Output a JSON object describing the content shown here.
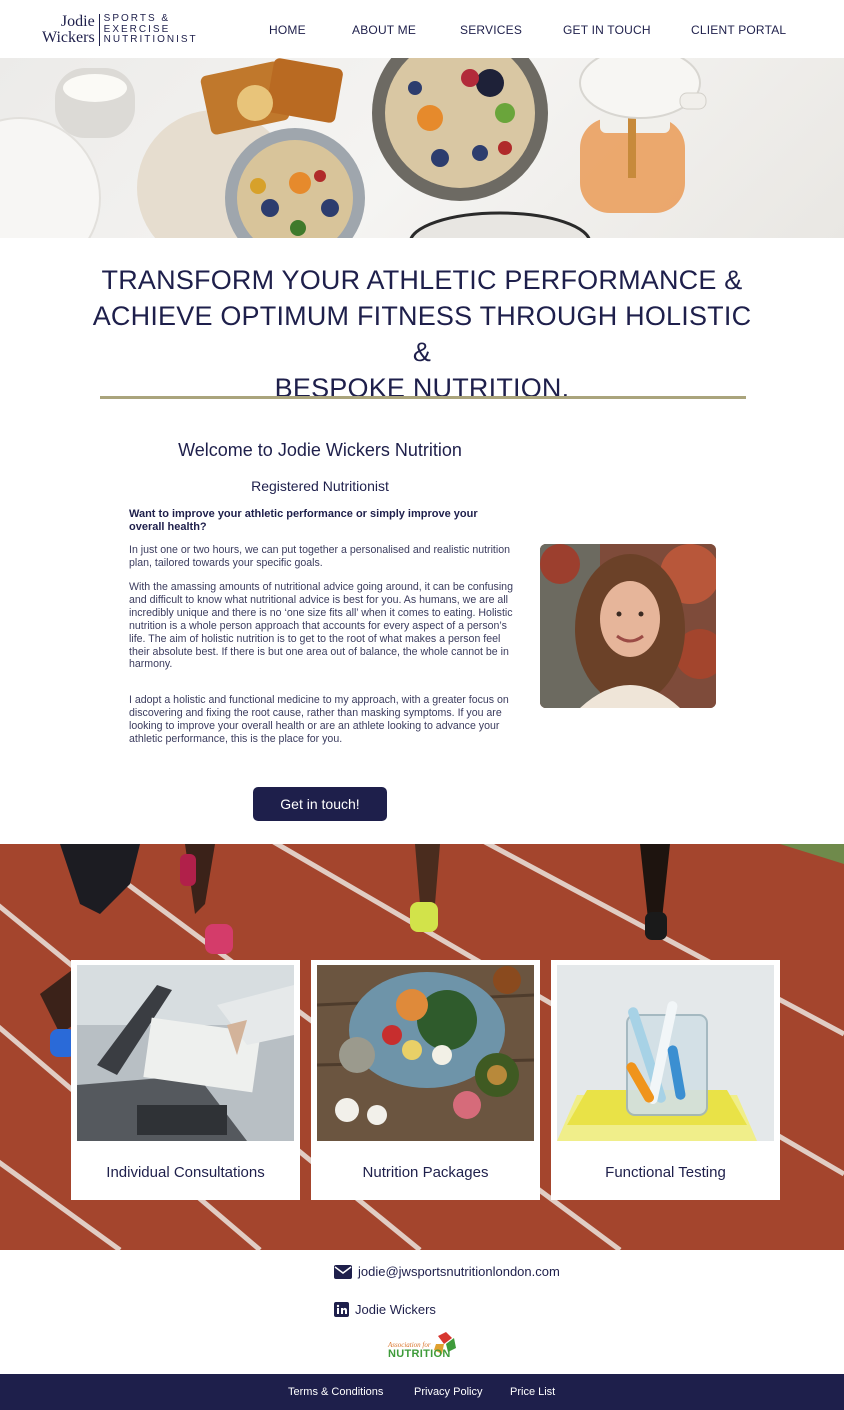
{
  "header": {
    "logo": {
      "name_line1": "Jodie",
      "name_line2": "Wickers",
      "tag_line1": "SPORTS &",
      "tag_line2": "EXERCISE",
      "tag_line3": "NUTRITIONIST"
    },
    "nav": [
      {
        "label": "HOME"
      },
      {
        "label": "ABOUT ME"
      },
      {
        "label": "SERVICES"
      },
      {
        "label": "GET IN TOUCH"
      },
      {
        "label": "CLIENT PORTAL"
      }
    ]
  },
  "hero": {
    "headline_line1": "TRANSFORM YOUR ATHLETIC PERFORMANCE &",
    "headline_line2": "ACHIEVE OPTIMUM FITNESS THROUGH HOLISTIC &",
    "headline_line3": "BESPOKE NUTRITION."
  },
  "welcome": {
    "title": "Welcome to Jodie Wickers Nutrition",
    "subtitle": "Registered Nutritionist",
    "lead": "Want to improve your athletic performance or simply improve your overall health?",
    "paragraphs": [
      "In just one or two hours, we can put together a personalised and realistic nutrition plan, tailored towards your specific goals.",
      "With the amassing amounts of nutritional advice going around, it can be confusing and difficult to know what nutritional advice is best for you. As humans, we are all incredibly unique and there is no ‘one size fits all’ when it comes to eating. Holistic nutrition is a whole person approach that accounts for every aspect of a person’s life. The aim of holistic nutrition is to get to the root of what makes a person feel their absolute best. If there is but one area out of balance, the whole cannot be in harmony.",
      "I adopt a holistic and functional medicine to my approach, with a greater focus on discovering and fixing the root cause, rather than masking symptoms. If you are looking to improve your overall health or are an athlete looking to advance your athletic performance, this is the place for you."
    ],
    "cta_label": "Get in touch!"
  },
  "services": [
    {
      "label": "Individual Consultations"
    },
    {
      "label": "Nutrition Packages"
    },
    {
      "label": "Functional Testing"
    }
  ],
  "contact": {
    "email": "jodie@jwsportsnutritionlondon.com",
    "linkedin": "Jodie Wickers",
    "badge_small": "Association for",
    "badge_big": "NUTRITION"
  },
  "footer": {
    "links": [
      {
        "label": "Terms & Conditions"
      },
      {
        "label": "Privacy Policy"
      },
      {
        "label": "Price List"
      }
    ]
  },
  "colors": {
    "navy": "#1e1f4b",
    "gold_rule": "#aaa47c",
    "track_red": "#a4452d"
  },
  "icons": [
    "envelope-icon",
    "linkedin-icon"
  ]
}
